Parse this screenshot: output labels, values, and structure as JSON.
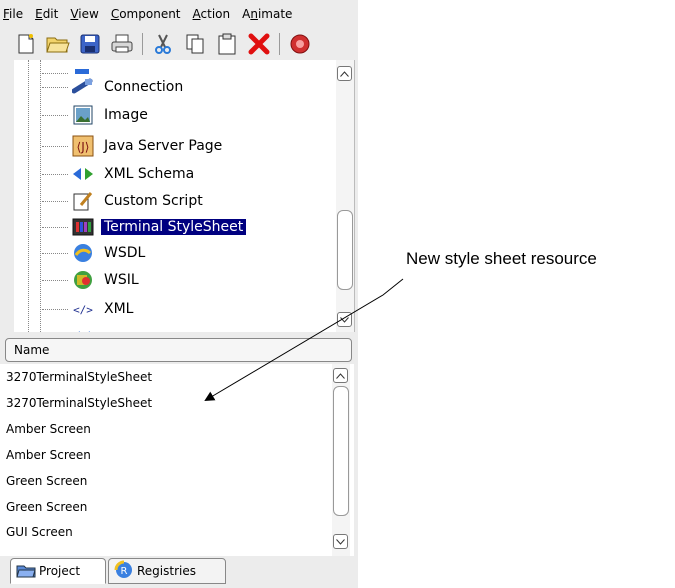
{
  "menu": [
    "File",
    "Edit",
    "View",
    "Component",
    "Action",
    "Animate"
  ],
  "menu_mnemonics": [
    0,
    0,
    0,
    0,
    0,
    1
  ],
  "toolbar": {
    "icons": [
      "new-file-icon",
      "open-folder-icon",
      "save-icon",
      "print-icon",
      "cut-icon",
      "copy-icon",
      "paste-icon",
      "delete-icon",
      "stop-icon"
    ]
  },
  "tree": {
    "items": [
      {
        "label": "Connection",
        "icon": "connection-icon"
      },
      {
        "label": "Image",
        "icon": "image-icon"
      },
      {
        "label": "Java Server Page",
        "icon": "jsp-icon"
      },
      {
        "label": "XML Schema",
        "icon": "xml-schema-icon"
      },
      {
        "label": "Custom Script",
        "icon": "custom-script-icon"
      },
      {
        "label": "Terminal StyleSheet",
        "icon": "terminal-stylesheet-icon",
        "selected": true
      },
      {
        "label": "WSDL",
        "icon": "wsdl-icon"
      },
      {
        "label": "WSIL",
        "icon": "wsil-icon"
      },
      {
        "label": "XML",
        "icon": "xml-icon"
      }
    ]
  },
  "list": {
    "header": "Name",
    "rows": [
      "3270TerminalStyleSheet",
      "3270TerminalStyleSheet",
      "Amber Screen",
      "Amber Screen",
      "Green Screen",
      "Green Screen",
      "GUI Screen"
    ]
  },
  "tabs": [
    {
      "label": "Project",
      "icon": "project-icon",
      "active": true
    },
    {
      "label": "Registries",
      "icon": "registries-icon",
      "active": false
    }
  ],
  "annotation": "New style sheet resource",
  "colors": {
    "selection": "#000080",
    "delete": "#e01010",
    "stop": "#d03030"
  }
}
